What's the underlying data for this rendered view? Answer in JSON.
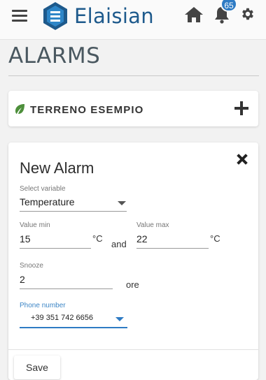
{
  "app": {
    "name": "Elaisian",
    "notification_count": "65",
    "brand_color": "#1e5a8c",
    "badge_color": "#2e7bc4"
  },
  "header": {
    "icons": [
      "hamburger-menu-icon",
      "home-icon",
      "bell-icon",
      "gear-icon"
    ]
  },
  "page": {
    "title": "ALARMS"
  },
  "field": {
    "name": "TERRENO ESEMPIO",
    "icon": "leaf-icon",
    "icon_color": "#4d8f3b"
  },
  "new_alarm": {
    "title": "New Alarm",
    "variable": {
      "label": "Select variable",
      "value": "Temperature"
    },
    "value_min": {
      "label": "Value min",
      "value": "15",
      "unit": "°C"
    },
    "joiner": "and",
    "value_max": {
      "label": "Value max",
      "value": "22",
      "unit": "°C"
    },
    "snooze": {
      "label": "Snooze",
      "value": "2",
      "unit": "ore"
    },
    "phone": {
      "label": "Phone number",
      "value": "+39 351 742 6656"
    },
    "save_label": "Save"
  }
}
